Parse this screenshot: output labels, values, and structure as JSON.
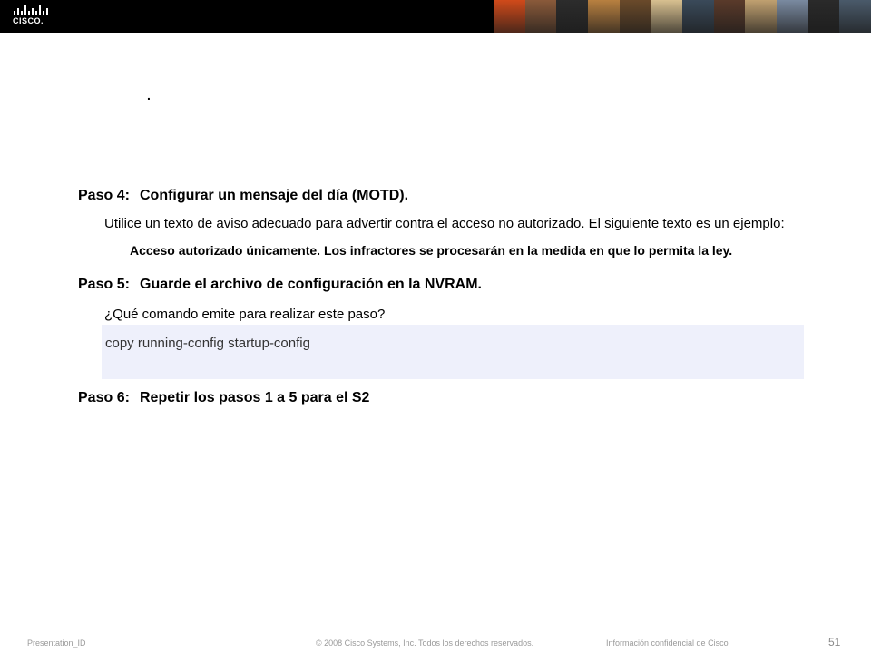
{
  "header": {
    "brand": "CISCO.",
    "photo_colors": [
      "#d04a1a",
      "#8a5a3a",
      "#2c2c2c",
      "#b88040",
      "#6a4a2a",
      "#d8c090",
      "#3a4a5a",
      "#5a3a2a",
      "#c0a070",
      "#7a8aa0",
      "#2a2a2a",
      "#4a5a6a"
    ]
  },
  "content": {
    "stray_dot": ".",
    "step4": {
      "number": "Paso 4:",
      "title": "Configurar un mensaje del día (MOTD).",
      "instruction": "Utilice un texto de aviso adecuado para advertir contra el acceso no autorizado. El siguiente texto es un ejemplo:",
      "example": "Acceso autorizado únicamente. Los infractores se procesarán en la medida en que lo permita la ley."
    },
    "step5": {
      "number": "Paso 5:",
      "title": "Guarde el archivo de configuración en la NVRAM.",
      "question": "¿Qué comando emite para realizar este paso?",
      "answer": "copy running-config startup-config"
    },
    "step6": {
      "number": "Paso 6:",
      "title": "Repetir los pasos 1 a 5 para el S2"
    }
  },
  "footer": {
    "presentation_id": "Presentation_ID",
    "copyright": "© 2008 Cisco Systems, Inc. Todos los derechos reservados.",
    "confidential": "Información confidencial de Cisco",
    "page_number": "51"
  }
}
